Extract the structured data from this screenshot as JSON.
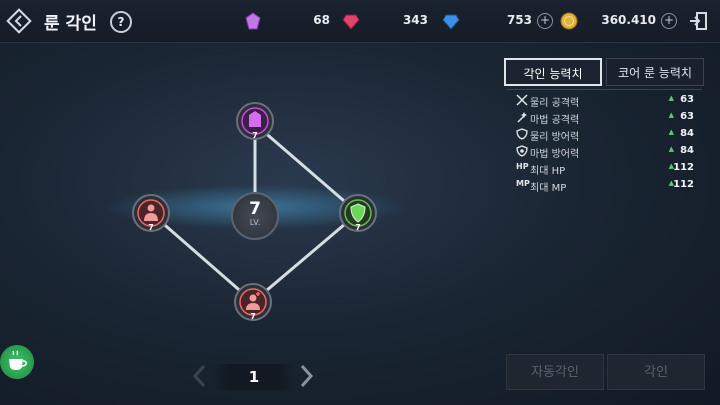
{
  "header": {
    "title": "룬 각인",
    "help_label": "?"
  },
  "currencies": [
    {
      "icon": "purple-crystal-icon",
      "value": "68"
    },
    {
      "icon": "red-gem-icon",
      "value": "343"
    },
    {
      "icon": "blue-gem-icon",
      "value": "753"
    },
    {
      "icon": "gold-coin-icon",
      "value": "360.410"
    }
  ],
  "plus_label": "+",
  "graph": {
    "center_level": "7",
    "center_unit": "LV.",
    "nodes": [
      {
        "name": "top",
        "level": "7",
        "color": "#c74be0"
      },
      {
        "name": "left",
        "level": "7",
        "color": "#e86a6a"
      },
      {
        "name": "right",
        "level": "7",
        "color": "#5fbf4f"
      },
      {
        "name": "bottom",
        "level": "7",
        "color": "#e86a6a"
      }
    ]
  },
  "pager": {
    "page": "1"
  },
  "tabs": {
    "active": "각인 능력치",
    "inactive": "코어 룬 능력치"
  },
  "stats": [
    {
      "icon": "crossed-swords-icon",
      "label": "물리 공격력",
      "value": "63"
    },
    {
      "icon": "magic-wand-icon",
      "label": "마법 공격력",
      "value": "63"
    },
    {
      "icon": "shield-icon",
      "label": "물리 방어력",
      "value": "84"
    },
    {
      "icon": "magic-shield-icon",
      "label": "마법 방어력",
      "value": "84"
    },
    {
      "icon_text": "HP",
      "label": "최대 HP",
      "value": "112"
    },
    {
      "icon_text": "MP",
      "label": "최대 MP",
      "value": "112"
    }
  ],
  "actions": {
    "auto_engrave": "자동각인",
    "engrave": "각인"
  }
}
